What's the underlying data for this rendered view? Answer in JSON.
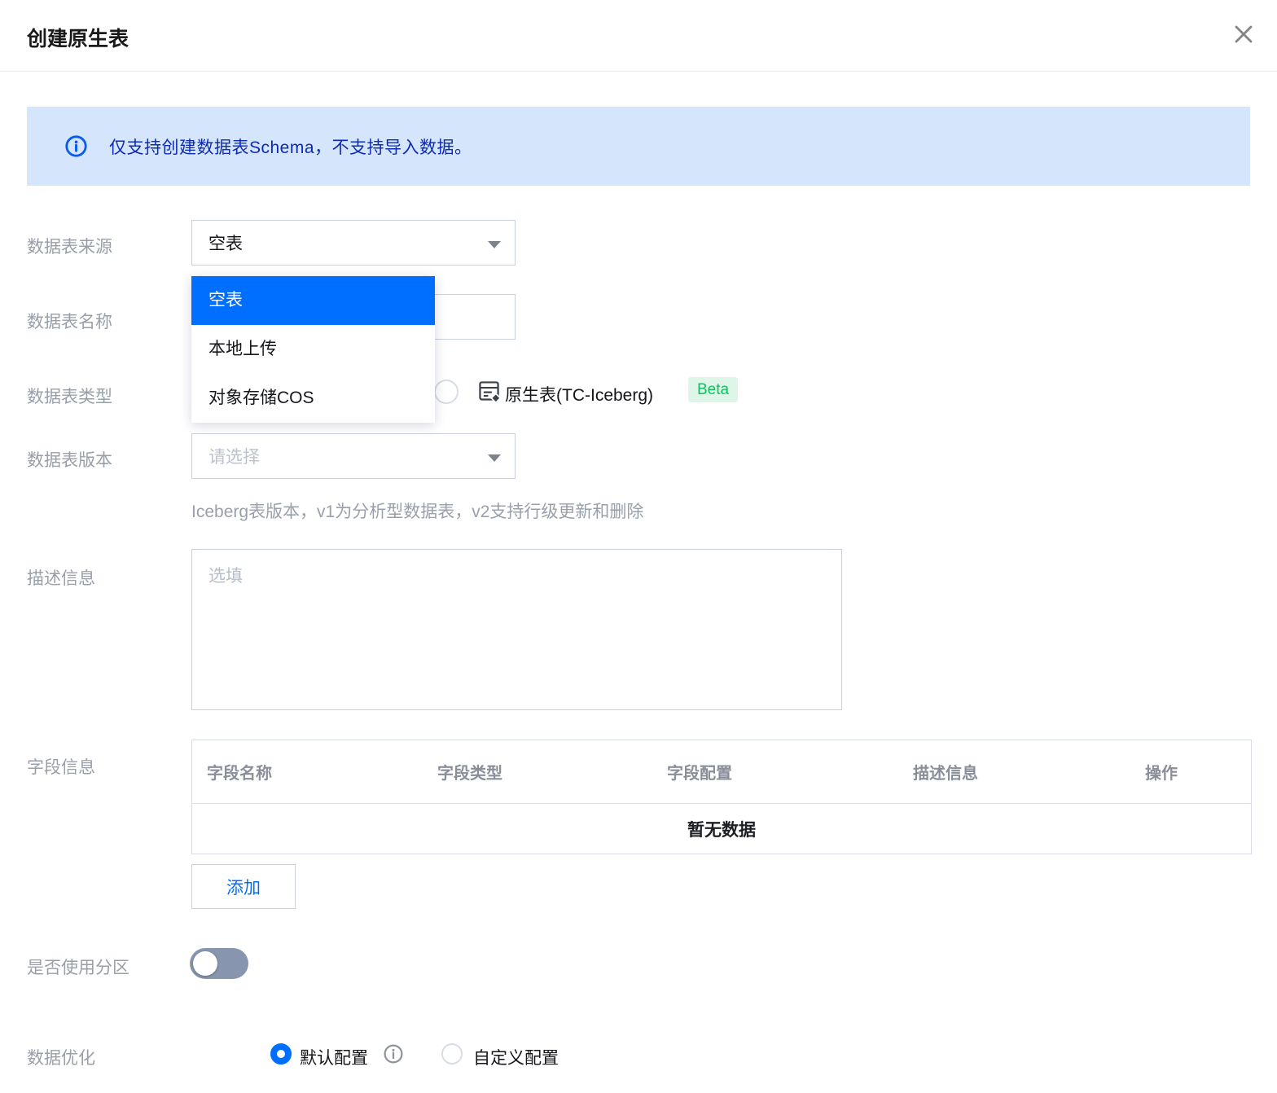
{
  "dialog": {
    "title": "创建原生表"
  },
  "banner": {
    "text": "仅支持创建数据表Schema，不支持导入数据。"
  },
  "form": {
    "source": {
      "label": "数据表来源",
      "value": "空表"
    },
    "source_dropdown": {
      "options": [
        {
          "label": "空表",
          "selected": true
        },
        {
          "label": "本地上传",
          "selected": false
        },
        {
          "label": "对象存储COS",
          "selected": false
        }
      ]
    },
    "name": {
      "label": "数据表名称",
      "value": "",
      "placeholder": ""
    },
    "type": {
      "label": "数据表类型",
      "option": {
        "label": "原生表(TC-Iceberg)",
        "badge": "Beta",
        "selected": false
      }
    },
    "version": {
      "label": "数据表版本",
      "placeholder": "请选择",
      "hint": "Iceberg表版本，v1为分析型数据表，v2支持行级更新和删除"
    },
    "description": {
      "label": "描述信息",
      "placeholder": "选填",
      "value": ""
    },
    "fields": {
      "label": "字段信息",
      "columns": [
        "字段名称",
        "字段类型",
        "字段配置",
        "描述信息",
        "操作"
      ],
      "empty_text": "暂无数据",
      "add_button": "添加"
    },
    "partition": {
      "label": "是否使用分区",
      "enabled": false
    },
    "optimization": {
      "label": "数据优化",
      "options": [
        {
          "label": "默认配置",
          "selected": true,
          "has_info": true
        },
        {
          "label": "自定义配置",
          "selected": false,
          "has_info": false
        }
      ]
    }
  },
  "colors": {
    "primary": "#006eff",
    "banner_bg": "#d5e5fb",
    "banner_text": "#0e2bb8",
    "beta_text": "#0fbf5f",
    "beta_bg": "#def6e7",
    "toggle_off": "#8796ae"
  }
}
